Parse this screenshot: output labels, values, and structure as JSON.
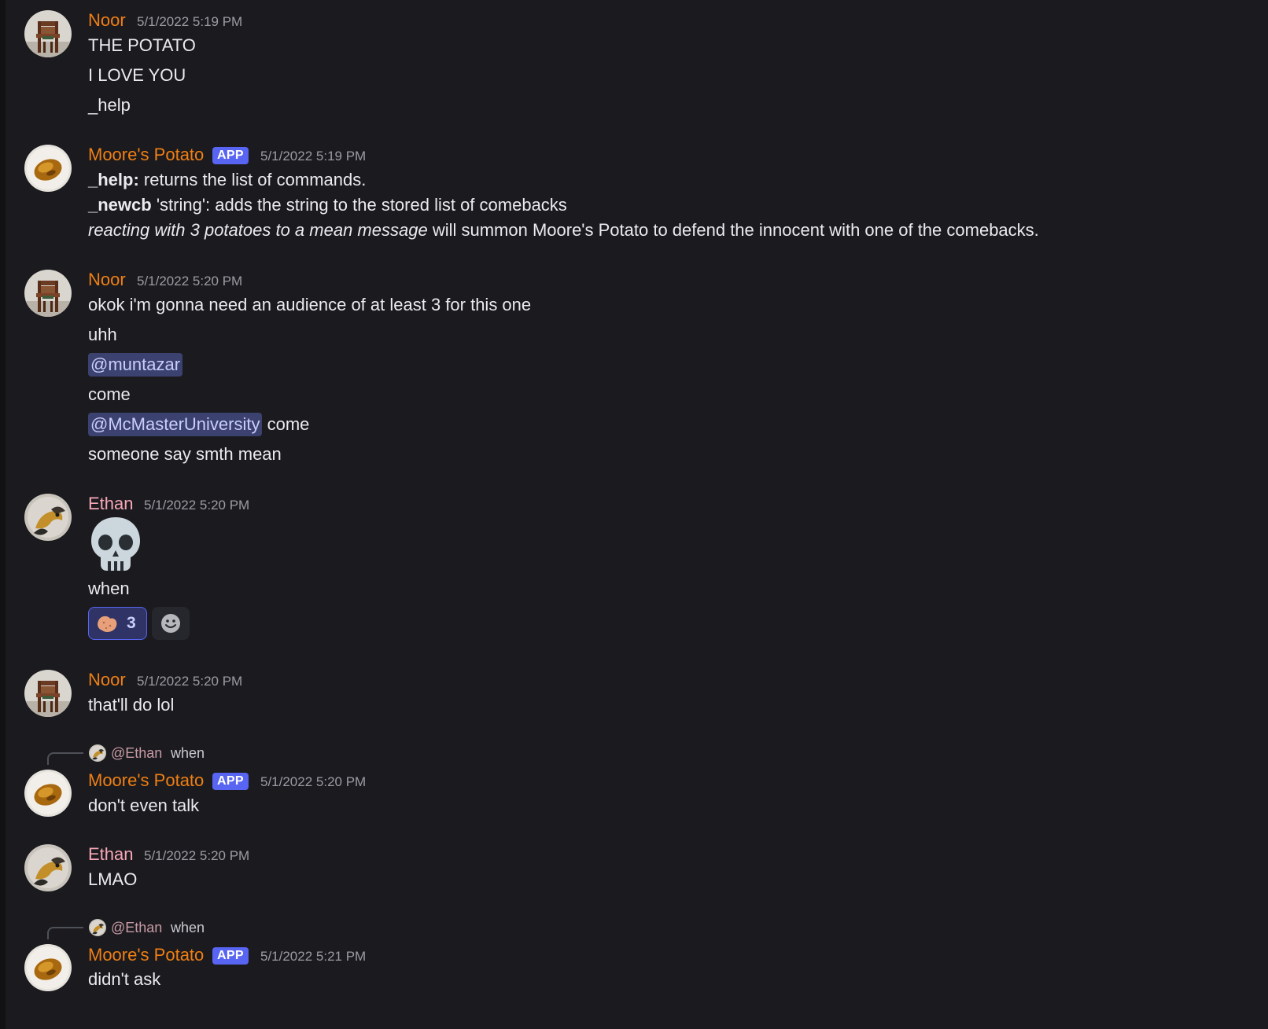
{
  "colors": {
    "background": "#1b1b1f",
    "noor": "#f07f13",
    "potato": "#f07f13",
    "ethan": "#f7a7b7",
    "app_badge": "#5865f2",
    "mention_bg": "#3c4270"
  },
  "users": {
    "noor": "Noor",
    "potato": "Moore's Potato",
    "ethan": "Ethan"
  },
  "badge": "APP",
  "messages": {
    "m1": {
      "time": "5/1/2022 5:19 PM",
      "lines": [
        "THE POTATO",
        "I LOVE YOU",
        "_help"
      ]
    },
    "m2": {
      "time": "5/1/2022 5:19 PM",
      "help_cmd": "_help:",
      "help_text": " returns the list of commands.",
      "newcb_cmd": "_newcb",
      "newcb_text": " 'string': adds the string to the stored list of comebacks",
      "react_ital": "reacting with 3 potatoes to a mean message",
      "react_text": " will summon Moore's Potato to defend the innocent with one of the comebacks."
    },
    "m3": {
      "time": "5/1/2022 5:20 PM",
      "line1": "okok i'm gonna need an audience of at least 3 for this one",
      "line2": "uhh",
      "mention1": "@muntazar",
      "line4": "come",
      "mention2": "@McMasterUniversity",
      "line5_after": " come",
      "line6": "someone say smth mean"
    },
    "m4": {
      "time": "5/1/2022 5:20 PM",
      "emoji": "skull",
      "text": "when",
      "reaction_count": "3",
      "reaction_icon": "potato-emoji",
      "add_reaction_icon": "smiley-icon"
    },
    "m5": {
      "time": "5/1/2022 5:20 PM",
      "text": "that'll do lol"
    },
    "m6": {
      "reply_name": "@Ethan",
      "reply_text": "when",
      "time": "5/1/2022 5:20 PM",
      "text": "don't even talk"
    },
    "m7": {
      "time": "5/1/2022 5:20 PM",
      "text": "LMAO"
    },
    "m8": {
      "reply_name": "@Ethan",
      "reply_text": "when",
      "time": "5/1/2022 5:21 PM",
      "text": "didn't ask"
    }
  }
}
